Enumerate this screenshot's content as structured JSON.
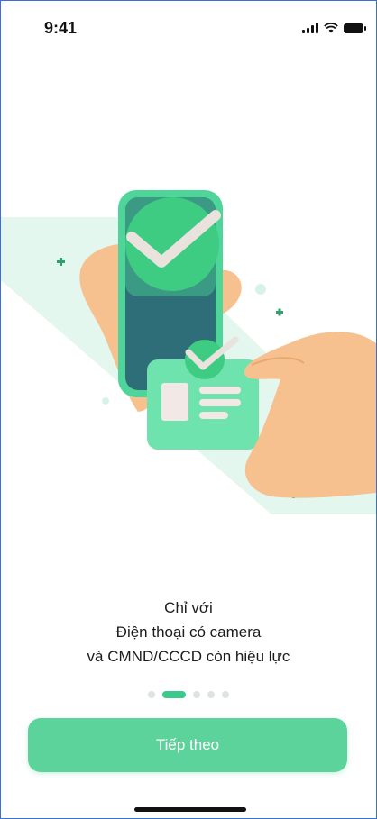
{
  "status_bar": {
    "time": "9:41"
  },
  "onboarding": {
    "lines": [
      "Chỉ với",
      "Điện thoại có camera",
      "và CMND/CCCD còn hiệu lực"
    ],
    "page_count": 5,
    "active_page": 2
  },
  "button": {
    "label": "Tiếp theo"
  },
  "colors": {
    "accent": "#3cc98c",
    "button": "#5bd39a",
    "skin": "#f6c08f",
    "card": "#6ee3ae"
  },
  "icons": [
    "signal-icon",
    "wifi-icon",
    "battery-icon"
  ]
}
